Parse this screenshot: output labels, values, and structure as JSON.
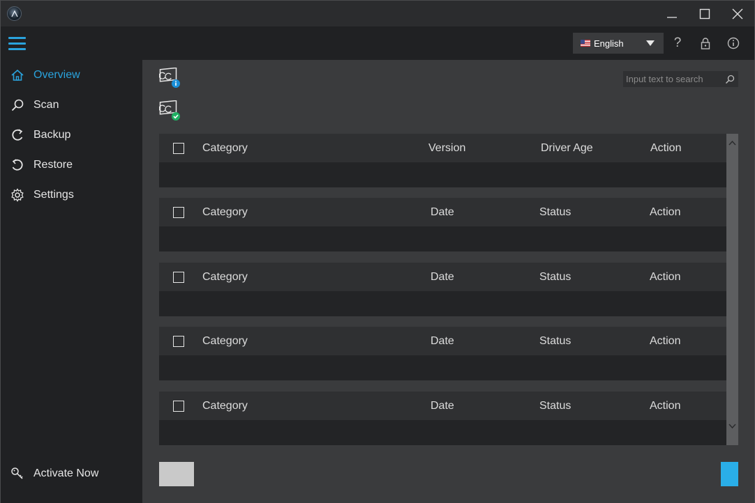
{
  "window": {
    "min_label": "",
    "max_label": "",
    "close_label": ""
  },
  "header": {
    "language": "English",
    "help_glyph": "?"
  },
  "sidebar": {
    "items": [
      {
        "label": "Overview",
        "icon": "home-icon",
        "active": true
      },
      {
        "label": "Scan",
        "icon": "search-icon",
        "active": false
      },
      {
        "label": "Backup",
        "icon": "backup-icon",
        "active": false
      },
      {
        "label": "Restore",
        "icon": "restore-icon",
        "active": false
      },
      {
        "label": "Settings",
        "icon": "gear-icon",
        "active": false
      }
    ],
    "activate_label": "Activate Now"
  },
  "search": {
    "placeholder": "Input text to search"
  },
  "tables": [
    {
      "columns": [
        "Category",
        "Version",
        "Driver Age",
        "Action"
      ]
    },
    {
      "columns": [
        "Category",
        "Date",
        "Status",
        "Action"
      ]
    },
    {
      "columns": [
        "Category",
        "Date",
        "Status",
        "Action"
      ]
    },
    {
      "columns": [
        "Category",
        "Date",
        "Status",
        "Action"
      ]
    },
    {
      "columns": [
        "Category",
        "Date",
        "Status",
        "Action"
      ]
    }
  ],
  "colors": {
    "accent": "#2aa3dd",
    "sidebar_bg": "#202123",
    "main_bg": "#3a3b3d",
    "header_row_bg": "#2f3032",
    "body_row_bg": "#232426",
    "primary_button": "#2aaee8",
    "secondary_button": "#c9c9c9"
  }
}
